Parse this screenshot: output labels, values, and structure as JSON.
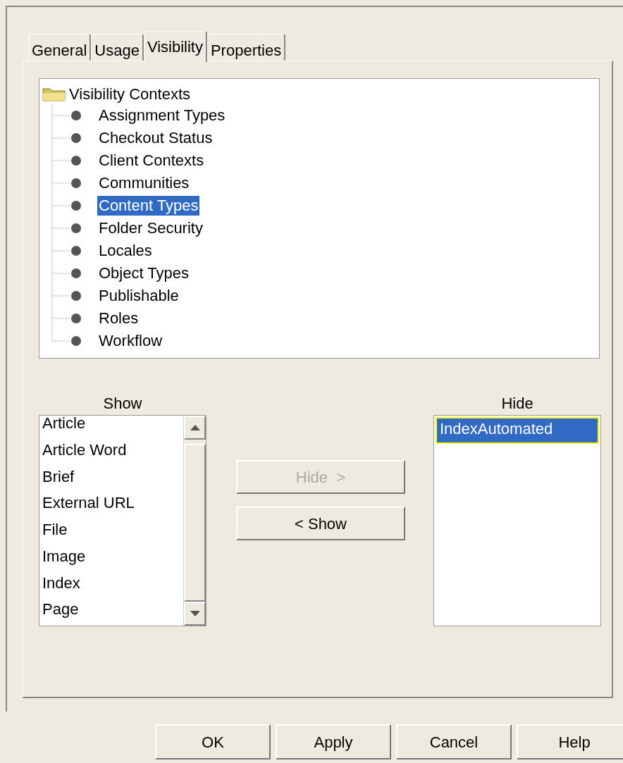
{
  "tabs": [
    {
      "label": "General",
      "selected": false
    },
    {
      "label": "Usage",
      "selected": false
    },
    {
      "label": "Visibility",
      "selected": true
    },
    {
      "label": "Properties",
      "selected": false
    }
  ],
  "tree": {
    "label": "Visibility Contexts",
    "children": [
      {
        "label": "Assignment Types",
        "selected": false
      },
      {
        "label": "Checkout Status",
        "selected": false
      },
      {
        "label": "Client Contexts",
        "selected": false
      },
      {
        "label": "Communities",
        "selected": false
      },
      {
        "label": "Content Types",
        "selected": true
      },
      {
        "label": "Folder Security",
        "selected": false
      },
      {
        "label": "Locales",
        "selected": false
      },
      {
        "label": "Object Types",
        "selected": false
      },
      {
        "label": "Publishable",
        "selected": false
      },
      {
        "label": "Roles",
        "selected": false
      },
      {
        "label": "Workflow",
        "selected": false
      }
    ]
  },
  "show_list": {
    "label": "Show",
    "items": [
      {
        "label": "Article",
        "selected": false
      },
      {
        "label": "Article Word",
        "selected": false
      },
      {
        "label": "Brief",
        "selected": false
      },
      {
        "label": "External URL",
        "selected": false
      },
      {
        "label": "File",
        "selected": false
      },
      {
        "label": "Image",
        "selected": false
      },
      {
        "label": "Index",
        "selected": false
      },
      {
        "label": "Page",
        "selected": false
      }
    ]
  },
  "move_buttons": [
    {
      "label": "Hide  >",
      "disabled": true
    },
    {
      "label": "< Show",
      "disabled": false
    }
  ],
  "hide_list": {
    "label": "Hide",
    "items": [
      {
        "label": "IndexAutomated",
        "selected": true
      }
    ]
  },
  "dialog_buttons": [
    "OK",
    "Apply",
    "Cancel",
    "Help"
  ]
}
